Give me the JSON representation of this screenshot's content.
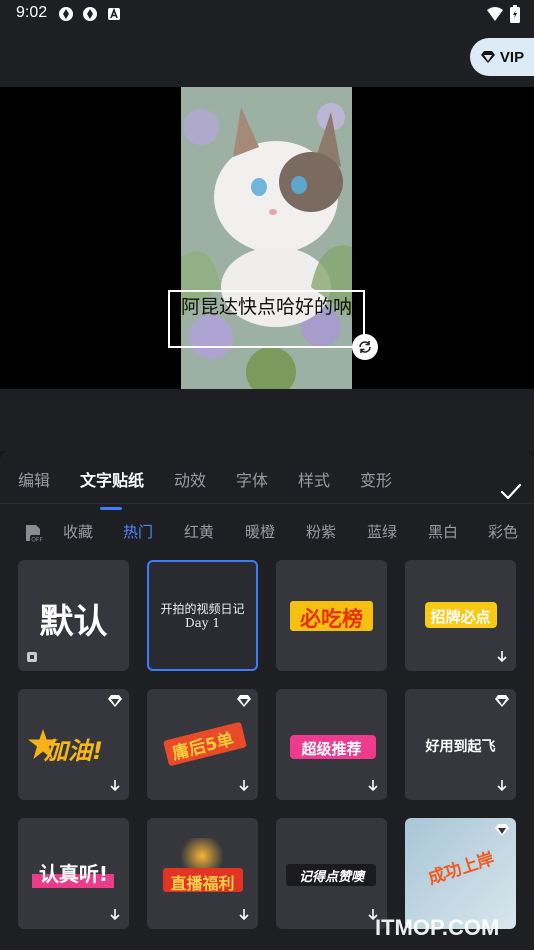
{
  "status": {
    "time": "9:02"
  },
  "vip": {
    "label": "VIP"
  },
  "preview": {
    "sticker_text": "阿昆达快点哈好的呐"
  },
  "main_tabs": [
    {
      "label": "编辑"
    },
    {
      "label": "文字贴纸"
    },
    {
      "label": "动效"
    },
    {
      "label": "字体"
    },
    {
      "label": "样式"
    },
    {
      "label": "变形"
    }
  ],
  "sub_tabs": [
    {
      "label": "收藏"
    },
    {
      "label": "热门"
    },
    {
      "label": "红黄"
    },
    {
      "label": "暖橙"
    },
    {
      "label": "粉紫"
    },
    {
      "label": "蓝绿"
    },
    {
      "label": "黑白"
    },
    {
      "label": "彩色"
    }
  ],
  "stickers": [
    {
      "text": "默认"
    },
    {
      "text": "开拍的视频日记",
      "sub": "Day 1"
    },
    {
      "text": "必吃榜"
    },
    {
      "text": "招牌必点"
    },
    {
      "text": "加油!"
    },
    {
      "text": "庸后5单"
    },
    {
      "text": "超级推荐"
    },
    {
      "text": "好用到起飞"
    },
    {
      "text": "认真听!"
    },
    {
      "text": "直播福利"
    },
    {
      "text": "记得点赞噢"
    },
    {
      "text": "成功上岸"
    }
  ],
  "watermark": "ITMOP.COM",
  "colors": {
    "accent": "#3d7bff",
    "panel": "#1e1f23",
    "card": "#36373c"
  }
}
